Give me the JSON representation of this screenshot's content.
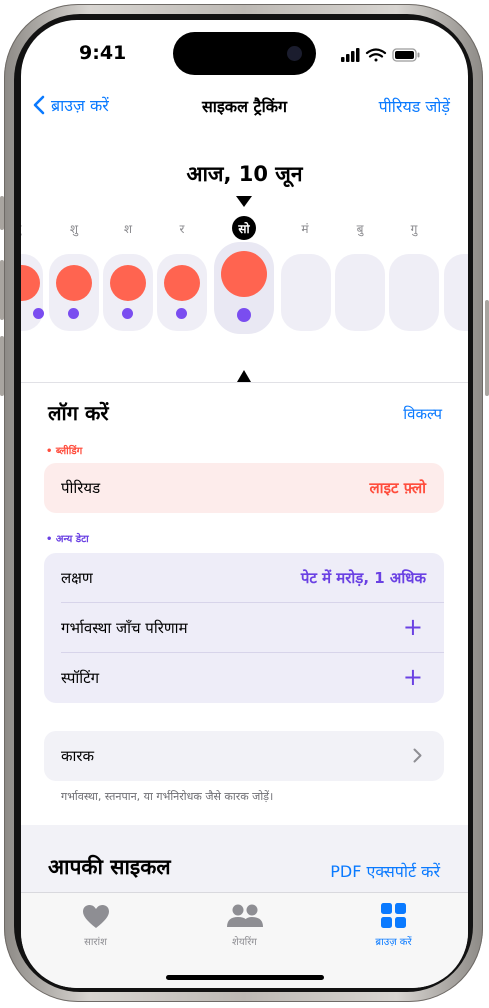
{
  "status": {
    "time": "9:41"
  },
  "nav": {
    "back_label": "ब्राउज़ करें",
    "title": "साइकल ट्रैकिंग",
    "add_label": "पीरियड जोड़ें"
  },
  "date_header": "आज, 10 जून",
  "days": [
    {
      "label": "बु"
    },
    {
      "label": "शु"
    },
    {
      "label": "श"
    },
    {
      "label": "र"
    },
    {
      "label": "सो",
      "today": true
    },
    {
      "label": "मं"
    },
    {
      "label": "बु"
    },
    {
      "label": "गु"
    }
  ],
  "log": {
    "title": "लॉग करें",
    "options_label": "विकल्प",
    "bleeding_tag": "• ब्लीडिंग",
    "period_label": "पीरियड",
    "period_value": "लाइट फ़्लो",
    "other_tag": "• अन्य डेटा",
    "rows": [
      {
        "label": "लक्षण",
        "value": "पेट में मरोड़, 1 अधिक"
      },
      {
        "label": "गर्भावस्था जाँच परिणाम",
        "value": "+"
      },
      {
        "label": "स्पॉटिंग",
        "value": "+"
      }
    ],
    "factors_label": "कारक",
    "factors_note": "गर्भावस्था, स्तनपान, या गर्भनिरोधक जैसे कारक जोड़ें।"
  },
  "cycle": {
    "title": "आपकी साइकल",
    "export_label": "PDF एक्सपोर्ट करें"
  },
  "tabs": [
    {
      "label": "सारांश",
      "icon": "heart-icon"
    },
    {
      "label": "शेयरिंग",
      "icon": "people-icon"
    },
    {
      "label": "ब्राउज़ करें",
      "icon": "grid-icon",
      "active": true
    }
  ],
  "colors": {
    "accent": "#0a7aff",
    "period": "#ff6450",
    "purple": "#7a4df0",
    "bleeding_bg": "#fdeceb",
    "other_bg": "#eeedf8"
  }
}
